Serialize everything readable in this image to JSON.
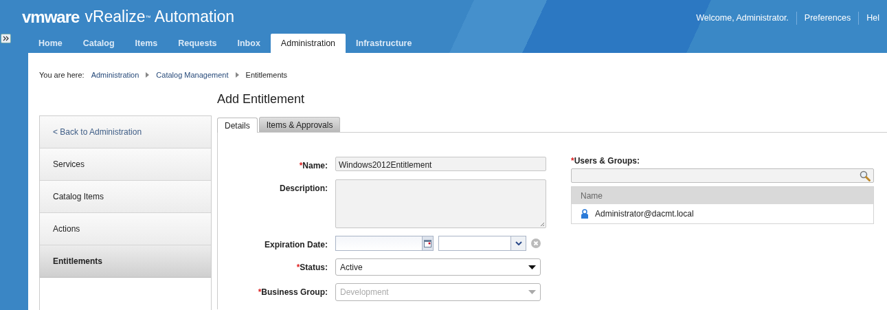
{
  "header": {
    "logo": "vmware",
    "product": "vRealize$^{™}$ Automation",
    "user_links": [
      "Welcome, Administrator.",
      "Preferences",
      "Hel"
    ]
  },
  "nav_tabs": [
    {
      "label": "Home",
      "selected": false
    },
    {
      "label": "Catalog",
      "selected": false
    },
    {
      "label": "Items",
      "selected": false
    },
    {
      "label": "Requests",
      "selected": false
    },
    {
      "label": "Inbox",
      "selected": false
    },
    {
      "label": "Administration",
      "selected": true
    },
    {
      "label": "Infrastructure",
      "selected": false
    }
  ],
  "breadcrumb": {
    "prefix": "You are here:",
    "items": [
      {
        "label": "Administration",
        "kind": "link"
      },
      {
        "label": "Catalog Management",
        "kind": "link"
      },
      {
        "label": "Entitlements",
        "kind": "current"
      }
    ]
  },
  "title": "Add Entitlement",
  "sidebar": {
    "items": [
      {
        "label": "< Back to Administration",
        "kind": "back",
        "selected": false
      },
      {
        "label": "Services",
        "kind": "item",
        "selected": false
      },
      {
        "label": "Catalog Items",
        "kind": "item",
        "selected": false
      },
      {
        "label": "Actions",
        "kind": "item",
        "selected": false
      },
      {
        "label": "Entitlements",
        "kind": "item",
        "selected": true
      }
    ]
  },
  "form_tabs": [
    {
      "label": "Details",
      "selected": true
    },
    {
      "label": "Items & Approvals",
      "selected": false
    }
  ],
  "required_mark": "*",
  "fields": [
    {
      "kind": "text",
      "label": "Name:",
      "required": true,
      "value": "Windows2012Entitlement"
    },
    {
      "kind": "textarea",
      "label": "Description:",
      "required": false
    },
    {
      "kind": "datetime",
      "label": "Expiration Date:",
      "required": false
    },
    {
      "kind": "select",
      "label": "Status:",
      "required": true,
      "value": "Active",
      "disabled": false
    },
    {
      "kind": "select",
      "label": "Business Group:",
      "required": true,
      "value": "Development",
      "disabled": true
    }
  ],
  "users_groups": {
    "label": "Users & Groups:",
    "required": true,
    "columns": [
      "Name"
    ],
    "rows": [
      {
        "name": "Administrator@dacmt.local"
      }
    ]
  }
}
